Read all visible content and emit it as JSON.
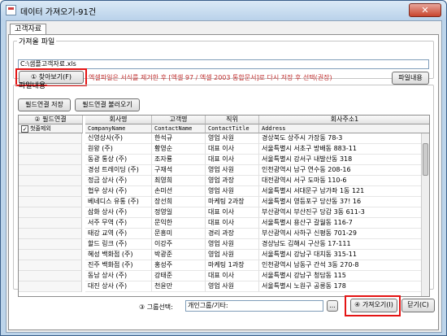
{
  "window": {
    "title": "데이터 가져오기-91건",
    "close_label": "✕"
  },
  "tab": {
    "label": "고객자료"
  },
  "file": {
    "legend": "가져올 파일",
    "path": "C:\\샘플고객자료.xls",
    "find_button": "① 찾아보기(F)",
    "notice": "엑셀파일은 서식를 제거한 후 [엑셀 97 / 엑셀 2003 통합문서]로 다시 저장 후 선택(권장)",
    "info_button": "파일내용"
  },
  "link": {
    "legend": "파일내용",
    "save_button": "필드연결 저장",
    "load_button": "필드연결 불러오기",
    "side_header": "② 필드연결",
    "first_row_label": "첫줄제외",
    "first_row_checked": "✓"
  },
  "grid": {
    "columns": [
      {
        "header": "회사명",
        "sub": "CompanyName"
      },
      {
        "header": "고객명",
        "sub": "ContactName"
      },
      {
        "header": "직위",
        "sub": "ContactTitle"
      },
      {
        "header": "회사주소1",
        "sub": "Address"
      }
    ],
    "rows": [
      [
        "신영상사(주)",
        "한석규",
        "영업 사원",
        "경상북도 상주시 가장동 78-3"
      ],
      [
        "원왕 (주)",
        "황영순",
        "대표 이사",
        "서울특별시 서초구 방배동 883-11"
      ],
      [
        "동광 통상 (주)",
        "조자룡",
        "대표 이사",
        "서울특별시 강서구 내발산동 318"
      ],
      [
        "경성 트레이딩 (주)",
        "구재석",
        "영업 사원",
        "인천광역시 남구 연수동 208-16"
      ],
      [
        "정금 상사 (주)",
        "최영희",
        "영업 과장",
        "대전광역시 서구 도마동 110-6"
      ],
      [
        "협우 상사 (주)",
        "손미선",
        "영업 사원",
        "서울특별시 서대문구 남가좌 1동 121"
      ],
      [
        "베네디스 유통 (주)",
        "장선희",
        "마케팅 2과장",
        "서울특별시 영등포구 당산동 37! 16"
      ],
      [
        "삼화 상사 (주)",
        "정영일",
        "대표 이사",
        "부산광역시 부산진구 당감 3동 611-3"
      ],
      [
        "서주 무역 (주)",
        "문익한",
        "대표 이사",
        "서울특별시 용산구 갈월동 116-7"
      ],
      [
        "태강 교역 (주)",
        "문흥미",
        "경리 과장",
        "부산광역시 사하구 신평동 701-29"
      ],
      [
        "할드 링크 (주)",
        "이강주",
        "영업 사원",
        "경상남도 김해시 구산동 17-111"
      ],
      [
        "혜성 백화점 (주)",
        "박광준",
        "영업 사원",
        "서울특별시 강남구 대치동 315-11"
      ],
      [
        "진주 백화점 (주)",
        "홍성주",
        "마케팅 1과장",
        "인천광역시 남동구 간석 3동 270-8"
      ],
      [
        "동남 상사 (주)",
        "강태준",
        "대표 이사",
        "서울특별시 강남구 청담동 115"
      ],
      [
        "대진 상사 (주)",
        "천윤만",
        "영업 사원",
        "서울특별시 노원구 공릉동 178"
      ]
    ]
  },
  "bottom": {
    "group_label": "③ 그룹선택:",
    "group_value": "개인그룹/기타:",
    "dots_button": "...",
    "import_button": "④ 가져오기(I)",
    "close_button": "닫기(C)"
  },
  "colors": {
    "highlight": "#e41414",
    "notice": "#c03030"
  }
}
